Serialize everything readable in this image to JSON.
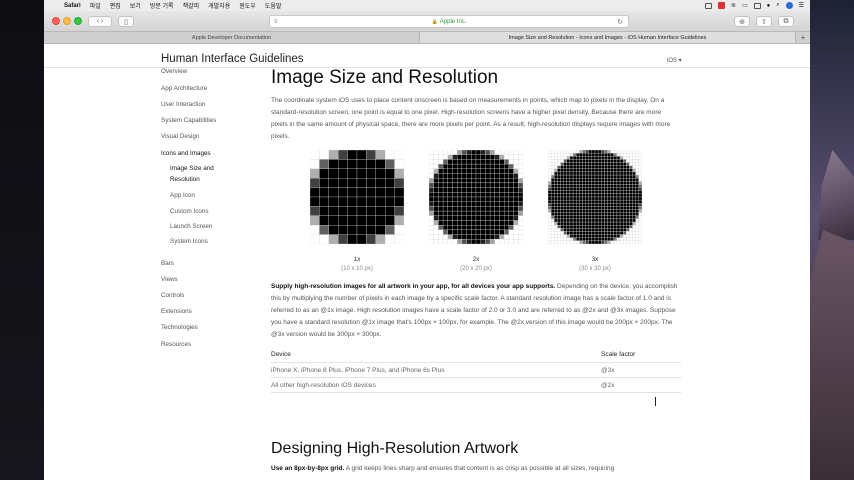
{
  "menubar": {
    "app_name": "Safari",
    "items": [
      "파일",
      "편집",
      "보기",
      "방문 기록",
      "책갈피",
      "개발자용",
      "윈도우",
      "도움말"
    ]
  },
  "browser": {
    "address": "Apple Inc.",
    "tabs": [
      {
        "title": "Apple Developer Documentation",
        "active": false
      },
      {
        "title": "Image Size and Resolution - Icons and Images - iOS Human Interface Guidelines",
        "active": true
      }
    ]
  },
  "localnav": {
    "title": "Human Interface Guidelines",
    "platform": "iOS ▾"
  },
  "sidebar": {
    "items": [
      {
        "label": "Overview",
        "level": 0
      },
      {
        "label": "App Architecture",
        "level": 0
      },
      {
        "label": "User Interaction",
        "level": 0
      },
      {
        "label": "System Capabilities",
        "level": 0
      },
      {
        "label": "Visual Design",
        "level": 0
      },
      {
        "label": "Icons and Images",
        "level": 0
      },
      {
        "label": "Image Size and Resolution",
        "level": 1
      },
      {
        "label": "App Icon",
        "level": 1
      },
      {
        "label": "Custom Icons",
        "level": 1
      },
      {
        "label": "Launch Screen",
        "level": 1
      },
      {
        "label": "System Icons",
        "level": 1
      },
      {
        "label": "Bars",
        "level": 0
      },
      {
        "label": "Views",
        "level": 0
      },
      {
        "label": "Controls",
        "level": 0
      },
      {
        "label": "Extensions",
        "level": 0
      },
      {
        "label": "Technologies",
        "level": 0
      },
      {
        "label": "Resources",
        "level": 0
      }
    ]
  },
  "content": {
    "heading": "Image Size and Resolution",
    "intro": "The coordinate system iOS uses to place content onscreen is based on measurements in points, which map to pixels in the display. On a standard-resolution screen, one point is equal to one pixel. High-resolution screens have a higher pixel density. Because there are more pixels in the same amount of physical space, there are more pixels per point. As a result, high-resolution displays require images with more pixels.",
    "figures": [
      {
        "scale": "1x",
        "size": "(10 x 10 px)"
      },
      {
        "scale": "2x",
        "size": "(20 x 20 px)"
      },
      {
        "scale": "3x",
        "size": "(30 x 30 px)"
      }
    ],
    "para_bold": "Supply high-resolution images for all artwork in your app, for all devices your app supports.",
    "para_rest": " Depending on the device, you accomplish this by multiplying the number of pixels in each image by a specific scale factor. A standard resolution image has a scale factor of 1.0 and is referred to as an @1x image. High resolution images have a scale factor of 2.0 or 3.0 and are referred to as @2x and @3x images. Suppose you have a standard resolution @1x image that's 100px × 100px, for example. The @2x version of this image would be 200px × 200px. The @3x version would be 300px × 300px.",
    "table": {
      "headers": [
        "Device",
        "Scale factor"
      ],
      "rows": [
        [
          "iPhone X, iPhone 8 Plus, iPhone 7 Plus, and iPhone 6s Plus",
          "@3x"
        ],
        [
          "All other high-resolution iOS devices",
          "@2x"
        ]
      ]
    },
    "heading2": "Designing High-Resolution Artwork",
    "para2_bold": "Use an 8px-by-8px grid.",
    "para2_rest": " A grid keeps lines sharp and ensures that content is as crisp as possible at all sizes, requiring"
  }
}
